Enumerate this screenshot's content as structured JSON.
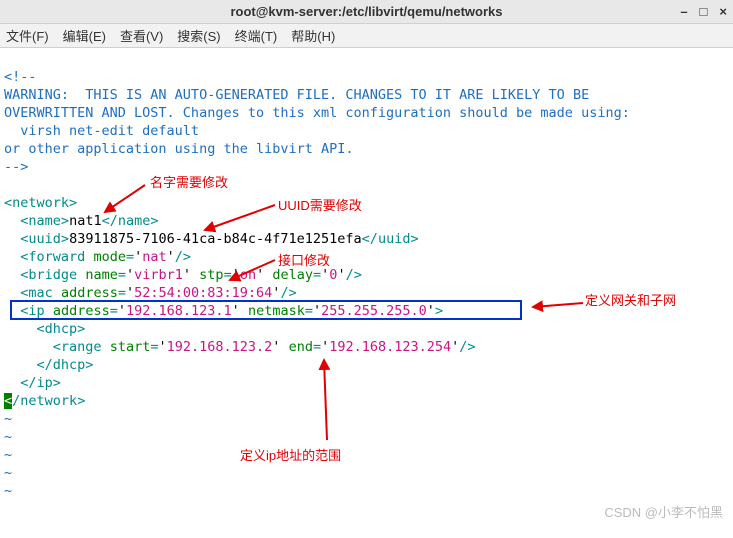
{
  "window": {
    "title": "root@kvm-server:/etc/libvirt/qemu/networks"
  },
  "menu": {
    "file": "文件(F)",
    "edit": "编辑(E)",
    "view": "查看(V)",
    "search": "搜索(S)",
    "terminal": "终端(T)",
    "help": "帮助(H)"
  },
  "comment": {
    "l1": "<!--",
    "l2": "WARNING:  THIS IS AN AUTO-GENERATED FILE. CHANGES TO IT ARE LIKELY TO BE",
    "l3": "OVERWRITTEN AND LOST. Changes to this xml configuration should be made using:",
    "l4": "  virsh net-edit default",
    "l5": "or other application using the libvirt API.",
    "l6": "-->"
  },
  "xml": {
    "network_open": "network",
    "network_close": "network",
    "name_tag": "name",
    "name_val": "nat1",
    "uuid_tag": "uuid",
    "uuid_val": "83911875-7106-41ca-b84c-4f71e1251efa",
    "forward_tag": "forward",
    "forward_mode_attr": "mode",
    "forward_mode_val": "nat",
    "bridge_tag": "bridge",
    "bridge_name_attr": "name",
    "bridge_name_val": "virbr1",
    "bridge_stp_attr": "stp",
    "bridge_stp_val": "on",
    "bridge_delay_attr": "delay",
    "bridge_delay_val": "0",
    "mac_tag": "mac",
    "mac_addr_attr": "address",
    "mac_addr_val": "52:54:00:83:19:64",
    "ip_tag": "ip",
    "ip_addr_attr": "address",
    "ip_addr_val": "192.168.123.1",
    "ip_mask_attr": "netmask",
    "ip_mask_val": "255.255.255.0",
    "dhcp_tag": "dhcp",
    "range_tag": "range",
    "range_start_attr": "start",
    "range_start_val": "192.168.123.2",
    "range_end_attr": "end",
    "range_end_val": "192.168.123.254",
    "ip_close": "ip"
  },
  "annotations": {
    "name_note": "名字需要修改",
    "uuid_note": "UUID需要修改",
    "bridge_note": "接口修改",
    "ip_note": "定义网关和子网",
    "range_note": "定义ip地址的范围"
  },
  "watermark": "CSDN @小李不怕黑"
}
